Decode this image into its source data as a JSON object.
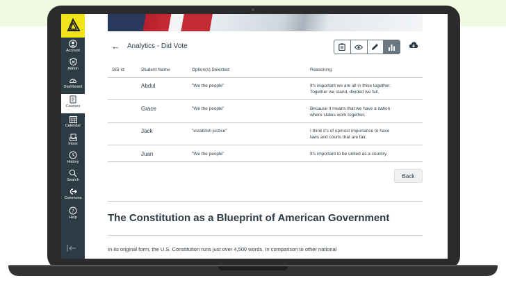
{
  "nav": {
    "items": [
      {
        "label": "Account",
        "icon": "account-icon",
        "glyph": "◉"
      },
      {
        "label": "Admin",
        "icon": "admin-shield-icon",
        "glyph": "⛉"
      },
      {
        "label": "Dashboard",
        "icon": "dashboard-icon",
        "glyph": "◠"
      },
      {
        "label": "Courses",
        "icon": "courses-book-icon",
        "glyph": "▤"
      },
      {
        "label": "Calendar",
        "icon": "calendar-icon",
        "glyph": "▦"
      },
      {
        "label": "Inbox",
        "icon": "inbox-icon",
        "glyph": "▭"
      },
      {
        "label": "History",
        "icon": "history-clock-icon",
        "glyph": "◷"
      },
      {
        "label": "Search",
        "icon": "search-icon",
        "glyph": "⌕"
      },
      {
        "label": "Commons",
        "icon": "commons-icon",
        "glyph": "➜"
      },
      {
        "label": "Help",
        "icon": "help-icon",
        "glyph": "?"
      }
    ],
    "active": "Courses",
    "collapse_glyph": "|←"
  },
  "header": {
    "back_glyph": "←",
    "title": "Analytics - Did Vote",
    "toolbar_icons": [
      "clipboard-icon",
      "eye-icon",
      "pencil-icon",
      "bar-chart-icon"
    ],
    "download_icon": "cloud-download-icon"
  },
  "table": {
    "headers": [
      "SIS Id",
      "Student Name",
      "Option(s) Selected",
      "Reasoning"
    ],
    "rows": [
      {
        "sis": "",
        "name": "Abdul",
        "option": "\"We the people\"",
        "reason_1": "It's important we are all in thise together.",
        "reason_2": "Together we stand, divided we fall."
      },
      {
        "sis": "",
        "name": "Grace",
        "option": "\"We the people\"",
        "reason_1": "Because it means that we have a nation",
        "reason_2": "where states work together."
      },
      {
        "sis": "",
        "name": "Jack",
        "option": "\"establish justice\"",
        "reason_1": "I think it's of upmost importance to have",
        "reason_2": "laws and courts that are fair."
      },
      {
        "sis": "",
        "name": "Juan",
        "option": "\"We the people\"",
        "reason_1": "It's important to be united as a country.",
        "reason_2": ""
      }
    ]
  },
  "back_button": "Back",
  "content": {
    "heading": "The Constitution as a Blueprint of American Government",
    "paragraph": "In its original form, the U.S. Constitution runs just over 4,500 words.  In comparison to other national"
  },
  "colors": {
    "nav_bg": "#2d3b45",
    "logo_bg": "#f0e31a",
    "text": "#2d3b45",
    "accent_band": "#f1fbe4"
  }
}
